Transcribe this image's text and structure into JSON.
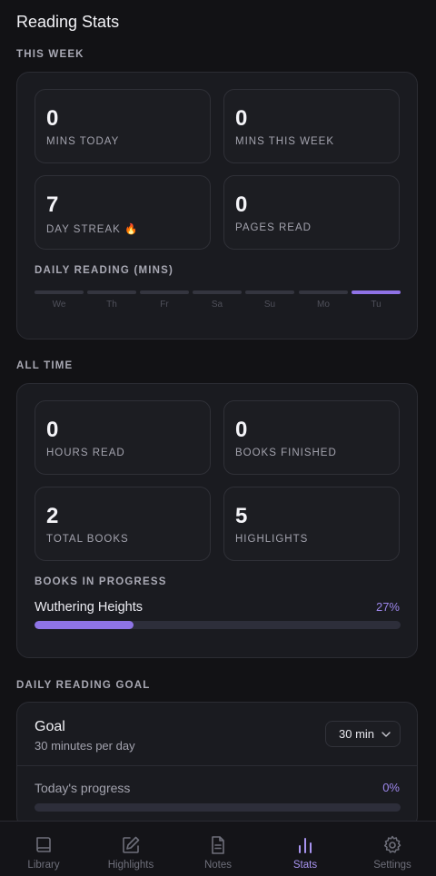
{
  "header": {
    "title": "Reading Stats"
  },
  "this_week": {
    "label": "THIS WEEK",
    "stats": [
      {
        "value": "0",
        "label": "MINS TODAY"
      },
      {
        "value": "0",
        "label": "MINS THIS WEEK"
      },
      {
        "value": "7",
        "label": "DAY STREAK 🔥"
      },
      {
        "value": "0",
        "label": "PAGES READ"
      }
    ],
    "daily_label": "DAILY READING (MINS)",
    "days": [
      "We",
      "Th",
      "Fr",
      "Sa",
      "Su",
      "Mo",
      "Tu"
    ],
    "active_day": "Tu"
  },
  "all_time": {
    "label": "ALL TIME",
    "stats": [
      {
        "value": "0",
        "label": "HOURS READ"
      },
      {
        "value": "0",
        "label": "BOOKS FINISHED"
      },
      {
        "value": "2",
        "label": "TOTAL BOOKS"
      },
      {
        "value": "5",
        "label": "HIGHLIGHTS"
      }
    ],
    "in_progress_label": "BOOKS IN PROGRESS",
    "books": [
      {
        "title": "Wuthering Heights",
        "percent_text": "27%",
        "progress": 0.27
      }
    ]
  },
  "goal": {
    "label": "DAILY READING GOAL",
    "title": "Goal",
    "subtitle": "30 minutes per day",
    "selected": "30 min",
    "today_label": "Today's progress",
    "today_percent_text": "0%",
    "today_progress": 0
  },
  "nav": {
    "items": [
      {
        "label": "Library",
        "icon": "book-icon"
      },
      {
        "label": "Highlights",
        "icon": "edit-icon"
      },
      {
        "label": "Notes",
        "icon": "document-icon"
      },
      {
        "label": "Stats",
        "icon": "bar-chart-icon"
      },
      {
        "label": "Settings",
        "icon": "gear-icon"
      }
    ],
    "active": "Stats"
  },
  "colors": {
    "accent": "#8e74e6",
    "background": "#121215",
    "panel": "#1a1b20"
  }
}
